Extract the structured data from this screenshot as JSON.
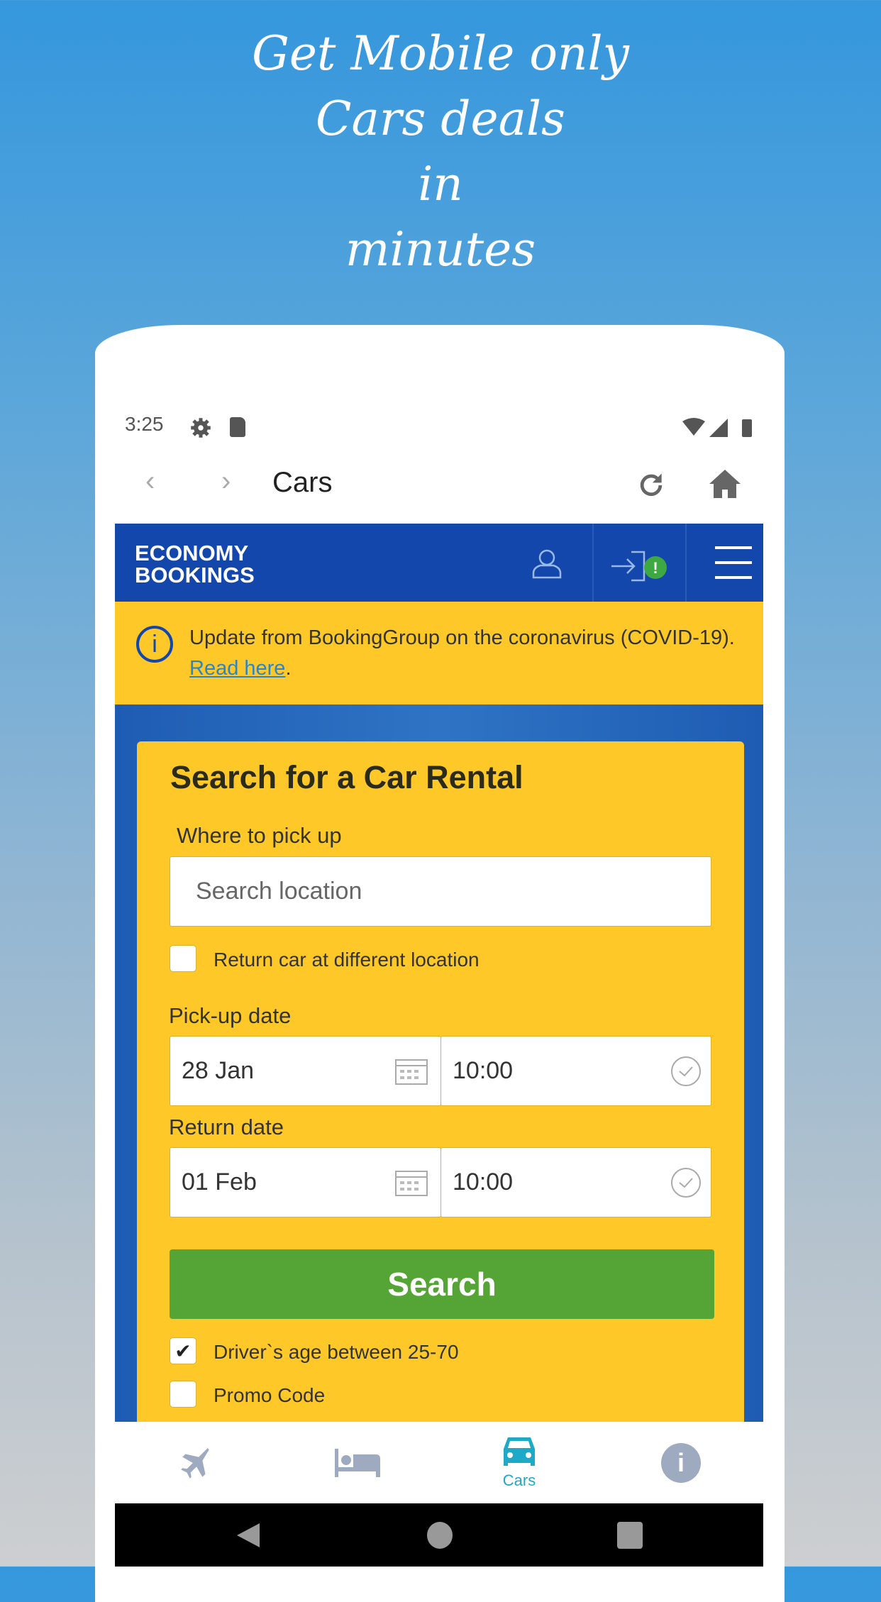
{
  "promo": {
    "lines": [
      "Get Mobile only",
      "Cars deals",
      "in",
      "minutes"
    ]
  },
  "status_bar": {
    "time": "3:25"
  },
  "toolbar": {
    "title": "Cars"
  },
  "header": {
    "logo_line1": "ECONOMY",
    "logo_line2": "BOOKINGS"
  },
  "banner": {
    "text": "Update from BookingGroup on the coronavirus (COVID-19). ",
    "link": "Read here",
    "end": "."
  },
  "search_form": {
    "title": "Search for a Car Rental",
    "pickup_label": "Where to pick up",
    "location_placeholder": "Search location",
    "return_different": {
      "label": "Return car at different location",
      "checked": false
    },
    "pickup_date_label": "Pick-up date",
    "pickup_date": "28 Jan",
    "pickup_time": "10:00",
    "return_date_label": "Return date",
    "return_date": "01 Feb",
    "return_time": "10:00",
    "search_label": "Search",
    "driver_age": {
      "label": "Driver`s age between 25-70",
      "checked": true
    },
    "promo_code": {
      "label": "Promo Code",
      "checked": false
    }
  },
  "bottom_nav": {
    "items": [
      {
        "icon": "plane-icon",
        "label": ""
      },
      {
        "icon": "bed-icon",
        "label": ""
      },
      {
        "icon": "car-icon",
        "label": "Cars",
        "active": true
      },
      {
        "icon": "info-icon",
        "label": ""
      }
    ],
    "active_color": "#1fa9c9"
  },
  "colors": {
    "brand_blue": "#1447ab",
    "yellow": "#fec829",
    "green": "#54a535"
  }
}
